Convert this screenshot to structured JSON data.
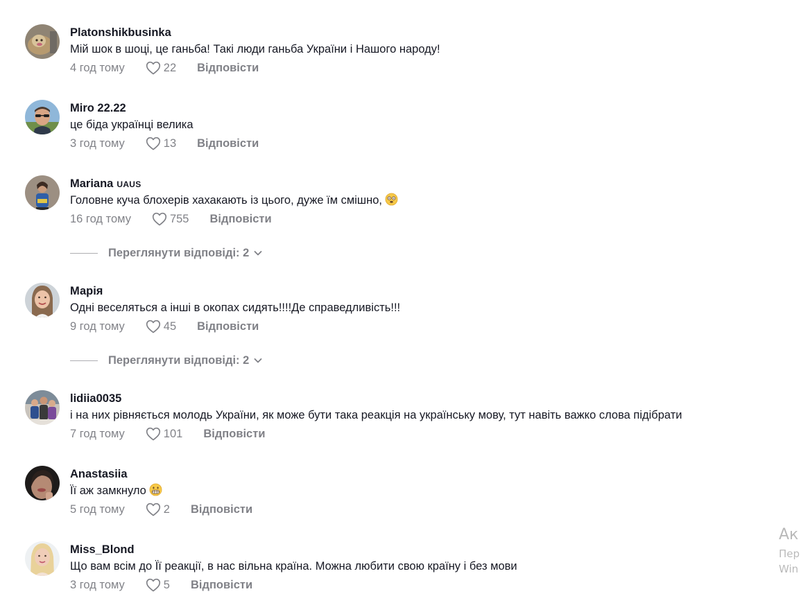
{
  "comments": [
    {
      "author": "Platonshikbusinka",
      "tag": "",
      "text": "Мій шок в шоці, це ганьба! Такі люди ганьба України і Нашого народу!",
      "emoji": "",
      "time": "4 год тому",
      "likes": "22",
      "reply": "Відповісти",
      "avatar": "avatar-gold-figure",
      "view_replies": ""
    },
    {
      "author": "Miro 22.22",
      "tag": "",
      "text": "це біда українці велика",
      "emoji": "",
      "time": "3 год тому",
      "likes": "13",
      "reply": "Відповісти",
      "avatar": "avatar-man-sunglasses",
      "view_replies": ""
    },
    {
      "author": "Mariana",
      "tag": "UAUS",
      "text": "Головне куча блохерів хахакають із цього, дуже їм смішно,",
      "emoji": "face-with-spiral-eyes",
      "time": "16 год тому",
      "likes": "755",
      "reply": "Відповісти",
      "avatar": "avatar-woman-blue",
      "view_replies": "Переглянути відповіді: 2"
    },
    {
      "author": "Марія",
      "tag": "",
      "text": "Одні веселяться а інші в окопах сидять!!!!Де справедливість!!!",
      "emoji": "",
      "time": "9 год тому",
      "likes": "45",
      "reply": "Відповісти",
      "avatar": "avatar-woman-smiling",
      "view_replies": "Переглянути відповіді: 2"
    },
    {
      "author": "lidiia0035",
      "tag": "",
      "text": "і на них рівняється молодь України, як може бути така реакція на українську мову, тут навіть важко слова підібрати",
      "emoji": "",
      "time": "7 год тому",
      "likes": "101",
      "reply": "Відповісти",
      "avatar": "avatar-group-photo",
      "view_replies": ""
    },
    {
      "author": "Anastasiia",
      "tag": "",
      "text": "Її аж замкнуло",
      "emoji": "grimacing-face",
      "time": "5 год тому",
      "likes": "2",
      "reply": "Відповісти",
      "avatar": "avatar-dark-portrait",
      "view_replies": ""
    },
    {
      "author": "Miss_Blond",
      "tag": "",
      "text": "Що вам всім до Її реакції, в нас вільна країна. Можна любити свою країну і без мови",
      "emoji": "",
      "time": "3 год тому",
      "likes": "5",
      "reply": "Відповісти",
      "avatar": "avatar-blonde-woman",
      "view_replies": ""
    }
  ],
  "overlay": {
    "title": "Ак",
    "line1": "Пер",
    "line2": "Win"
  },
  "colors": {
    "text": "#161823",
    "muted": "rgba(22,24,35,0.55)",
    "background": "#ffffff"
  },
  "icons": {
    "like": "heart-outline-icon",
    "expand": "chevron-down-icon"
  }
}
